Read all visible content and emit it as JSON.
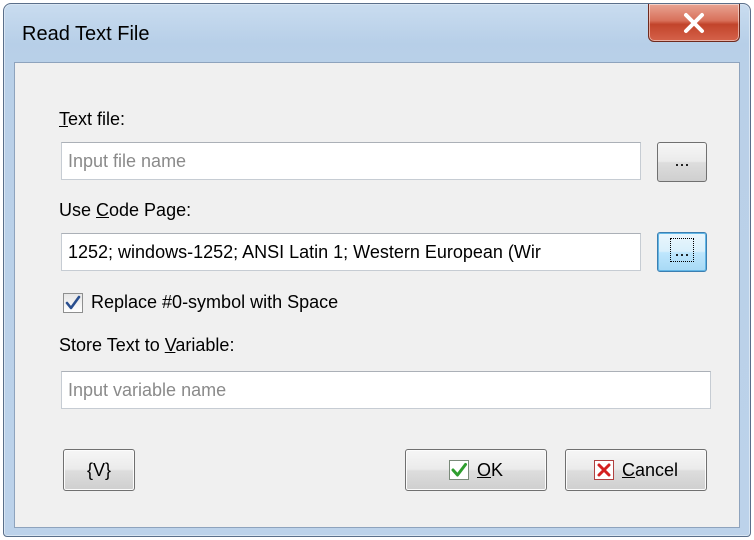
{
  "window": {
    "title": "Read Text File",
    "close_glyph": "x"
  },
  "text_file": {
    "label_accel": "T",
    "label_rest": "ext file:",
    "placeholder": "Input file name",
    "value": "",
    "browse_label": "..."
  },
  "code_page": {
    "label_pre": "Use ",
    "label_accel": "C",
    "label_rest": "ode Page:",
    "value": "1252; windows-1252; ANSI Latin 1; Western European (Wir",
    "browse_label": "..."
  },
  "replace_option": {
    "label": "Replace #0-symbol with Space",
    "checked": true
  },
  "store_variable": {
    "label_pre": "Store Text to ",
    "label_accel": "V",
    "label_rest": "ariable:",
    "placeholder": "Input variable name",
    "value": ""
  },
  "buttons": {
    "variables_label": "{V}",
    "ok_accel": "O",
    "ok_rest": "K",
    "cancel_accel": "C",
    "cancel_rest": "ancel"
  },
  "icons": {
    "ok": "checkmark-icon",
    "cancel": "red-x-icon",
    "close": "close-icon",
    "checkbox": "checkmark-icon"
  },
  "colors": {
    "frame": "#b9d0e8",
    "close_button": "#c2442b",
    "ok_check": "#2e9e2e",
    "cancel_x": "#d42020",
    "focus_border": "#3c7fb1"
  }
}
